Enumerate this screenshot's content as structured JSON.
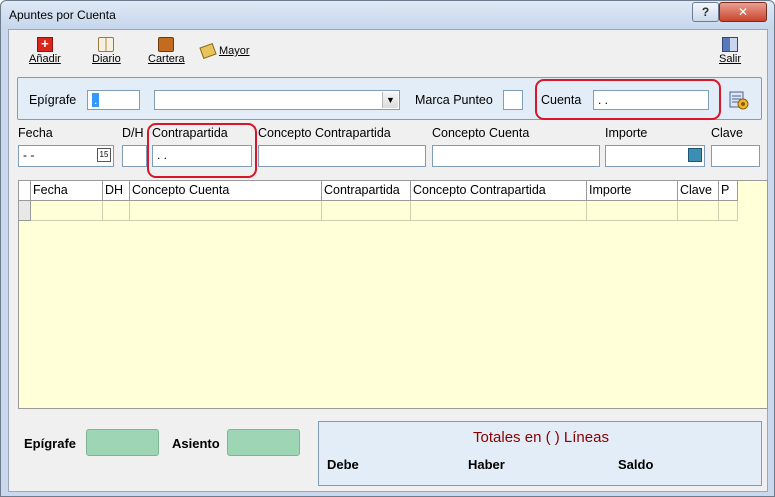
{
  "window": {
    "title": "Apuntes por Cuenta",
    "help_label": "?",
    "close_label": "✕"
  },
  "toolbar": {
    "add_label": "Añadir",
    "diario_label": "Diario",
    "cartera_label": "Cartera",
    "mayor_label": "Mayor",
    "salir_label": "Salir"
  },
  "filter": {
    "epigrafe_label": "Epígrafe",
    "epigrafe_value": ".",
    "selector_value": "",
    "marca_punteo_label": "Marca Punteo",
    "cuenta_label": "Cuenta",
    "cuenta_value": " .  ."
  },
  "entry": {
    "fecha_label": "Fecha",
    "fecha_value": " - -",
    "dh_label": "D/H",
    "contrapartida_label": "Contrapartida",
    "contrapartida_value": " .  .",
    "concepto_contrapartida_label": "Concepto Contrapartida",
    "concepto_cuenta_label": "Concepto Cuenta",
    "importe_label": "Importe",
    "clave_label": "Clave",
    "calendar_icon_text": "15"
  },
  "grid": {
    "columns": [
      "Fecha",
      "DH",
      "Concepto Cuenta",
      "Contrapartida",
      "Concepto Contrapartida",
      "Importe",
      "Clave",
      "P"
    ]
  },
  "footer": {
    "epigrafe_label": "Epígrafe",
    "asiento_label": "Asiento",
    "totals_title": "Totales en (   )  Líneas",
    "debe_label": "Debe",
    "haber_label": "Haber",
    "saldo_label": "Saldo"
  },
  "colors": {
    "grid_background": "#ffffd8",
    "highlight": "#d7162a",
    "totals_title": "#8b0000",
    "green_box": "#9ed5b4"
  }
}
